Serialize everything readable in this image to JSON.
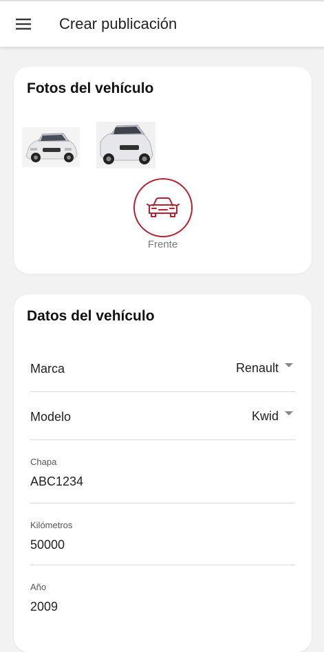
{
  "app_bar": {
    "title": "Crear publicación",
    "menu_icon": "hamburger-menu-icon"
  },
  "photos_card": {
    "title": "Fotos del vehículo",
    "thumbnails": [
      {
        "name": "car-front-photo"
      },
      {
        "name": "car-three-quarter-photo"
      }
    ],
    "add_photo": {
      "icon": "car-front-icon",
      "label": "Frente",
      "accent_color": "#b5212f"
    }
  },
  "data_card": {
    "title": "Datos del vehículo",
    "fields": {
      "marca": {
        "label": "Marca",
        "value": "Renault"
      },
      "modelo": {
        "label": "Modelo",
        "value": "Kwid"
      },
      "chapa": {
        "label": "Chapa",
        "value": "ABC1234"
      },
      "kilometros": {
        "label": "Kilómetros",
        "value": "50000"
      },
      "anio": {
        "label": "Año",
        "value": "2009"
      }
    }
  },
  "colors": {
    "background": "#f2f2f2",
    "card": "#ffffff",
    "accent": "#b5212f",
    "divider": "#d9d9d9"
  }
}
